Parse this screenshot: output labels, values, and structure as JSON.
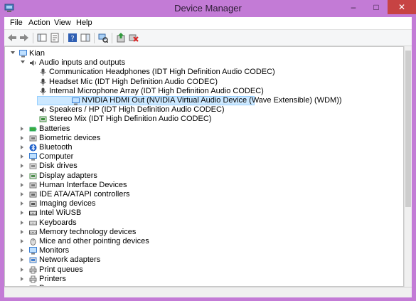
{
  "window": {
    "title": "Device Manager"
  },
  "caption_buttons": {
    "minimize": "–",
    "maximize": "□",
    "close": "✕"
  },
  "menu": [
    "File",
    "Action",
    "View",
    "Help"
  ],
  "toolbar_icons": [
    "back-arrow-icon",
    "forward-arrow-icon",
    "show-hide-console-tree-icon",
    "properties-icon",
    "help-icon",
    "action-pane-icon",
    "scan-hardware-icon",
    "update-driver-icon",
    "uninstall-device-icon"
  ],
  "tree": {
    "root": "Kian",
    "expanded_category": "Audio inputs and outputs",
    "audio_children": [
      {
        "label": "Communication Headphones (IDT High Definition Audio CODEC)",
        "icon": "headphones-icon",
        "selected": false
      },
      {
        "label": "Headset Mic (IDT High Definition Audio CODEC)",
        "icon": "microphone-icon",
        "selected": false
      },
      {
        "label": "Internal Microphone Array (IDT High Definition Audio CODEC)",
        "icon": "microphone-icon",
        "selected": false
      },
      {
        "label": "NVIDIA HDMI Out (NVIDIA Virtual Audio Device (Wave Extensible) (WDM))",
        "icon": "monitor-audio-icon",
        "selected": true
      },
      {
        "label": "Speakers / HP (IDT High Definition Audio CODEC)",
        "icon": "speaker-icon",
        "selected": false
      },
      {
        "label": "Stereo Mix (IDT High Definition Audio CODEC)",
        "icon": "sound-card-icon",
        "selected": false
      }
    ],
    "categories": [
      {
        "label": "Batteries",
        "icon": "battery-icon"
      },
      {
        "label": "Biometric devices",
        "icon": "fingerprint-icon"
      },
      {
        "label": "Bluetooth",
        "icon": "bluetooth-icon"
      },
      {
        "label": "Computer",
        "icon": "computer-icon"
      },
      {
        "label": "Disk drives",
        "icon": "disk-drive-icon"
      },
      {
        "label": "Display adapters",
        "icon": "display-adapter-icon"
      },
      {
        "label": "Human Interface Devices",
        "icon": "hid-icon"
      },
      {
        "label": "IDE ATA/ATAPI controllers",
        "icon": "ide-controller-icon"
      },
      {
        "label": "Imaging devices",
        "icon": "camera-icon"
      },
      {
        "label": "Intel WiUSB",
        "icon": "usb-icon"
      },
      {
        "label": "Keyboards",
        "icon": "keyboard-icon"
      },
      {
        "label": "Memory technology devices",
        "icon": "memory-icon"
      },
      {
        "label": "Mice and other pointing devices",
        "icon": "mouse-icon"
      },
      {
        "label": "Monitors",
        "icon": "monitor-icon"
      },
      {
        "label": "Network adapters",
        "icon": "network-adapter-icon"
      },
      {
        "label": "Print queues",
        "icon": "print-queue-icon"
      },
      {
        "label": "Printers",
        "icon": "printer-icon"
      },
      {
        "label": "Processors",
        "icon": "processor-icon"
      }
    ]
  },
  "colors": {
    "titlebar": "#c37bd6",
    "close_button": "#c74343",
    "selection_fill": "#cce8ff",
    "selection_border": "#99d1ff"
  }
}
